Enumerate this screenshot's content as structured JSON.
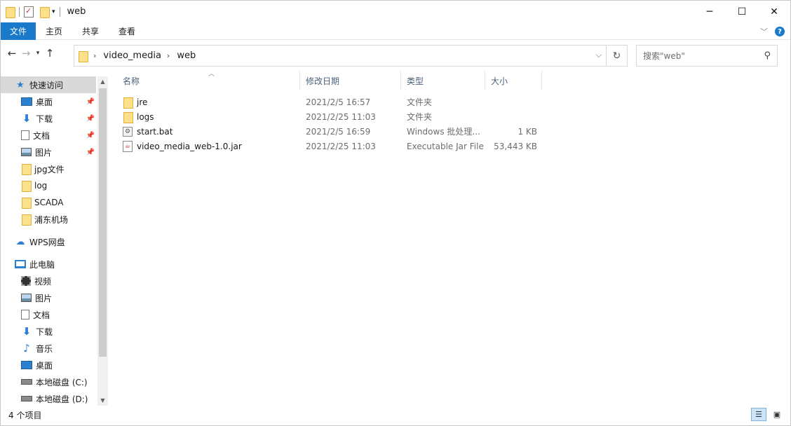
{
  "window": {
    "title": "web",
    "controls": {
      "minimize": "─",
      "maximize": "☐",
      "close": "✕"
    }
  },
  "ribbon": {
    "tabs": [
      {
        "label": "文件"
      },
      {
        "label": "主页"
      },
      {
        "label": "共享"
      },
      {
        "label": "查看"
      }
    ],
    "help_glyph": "?"
  },
  "address": {
    "crumbs": [
      "video_media",
      "web"
    ],
    "search_placeholder": "搜索\"web\""
  },
  "sidebar": {
    "quick_access": {
      "label": "快速访问",
      "items": [
        {
          "label": "桌面",
          "icon": "desktop-icon",
          "pinned": true
        },
        {
          "label": "下载",
          "icon": "download-icon",
          "pinned": true
        },
        {
          "label": "文档",
          "icon": "document-icon",
          "pinned": true
        },
        {
          "label": "图片",
          "icon": "pictures-icon",
          "pinned": true
        },
        {
          "label": "jpg文件",
          "icon": "folder-icon",
          "pinned": false
        },
        {
          "label": "log",
          "icon": "folder-icon",
          "pinned": false
        },
        {
          "label": "SCADA",
          "icon": "folder-icon",
          "pinned": false
        },
        {
          "label": "浦东机场",
          "icon": "folder-icon",
          "pinned": false
        }
      ]
    },
    "wps": {
      "label": "WPS网盘"
    },
    "this_pc": {
      "label": "此电脑",
      "items": [
        {
          "label": "视频",
          "icon": "video-icon"
        },
        {
          "label": "图片",
          "icon": "pictures-icon"
        },
        {
          "label": "文档",
          "icon": "document-icon"
        },
        {
          "label": "下载",
          "icon": "download-icon"
        },
        {
          "label": "音乐",
          "icon": "music-icon"
        },
        {
          "label": "桌面",
          "icon": "desktop-icon"
        },
        {
          "label": "本地磁盘 (C:)",
          "icon": "drive-icon"
        },
        {
          "label": "本地磁盘 (D:)",
          "icon": "drive-icon"
        }
      ]
    }
  },
  "file_list": {
    "columns": {
      "name": "名称",
      "date": "修改日期",
      "type": "类型",
      "size": "大小"
    },
    "rows": [
      {
        "name": "jre",
        "date": "2021/2/5 16:57",
        "type": "文件夹",
        "size": "",
        "icon": "folder-icon"
      },
      {
        "name": "logs",
        "date": "2021/2/25 11:03",
        "type": "文件夹",
        "size": "",
        "icon": "folder-icon"
      },
      {
        "name": "start.bat",
        "date": "2021/2/5 16:59",
        "type": "Windows 批处理...",
        "size": "1 KB",
        "icon": "batch-file-icon"
      },
      {
        "name": "video_media_web-1.0.jar",
        "date": "2021/2/25 11:03",
        "type": "Executable Jar File",
        "size": "53,443 KB",
        "icon": "jar-file-icon"
      }
    ]
  },
  "status": {
    "item_count": "4 个项目"
  },
  "colors": {
    "accent": "#1979ca",
    "selection": "#d9d9d9",
    "header_text": "#4c607a"
  }
}
